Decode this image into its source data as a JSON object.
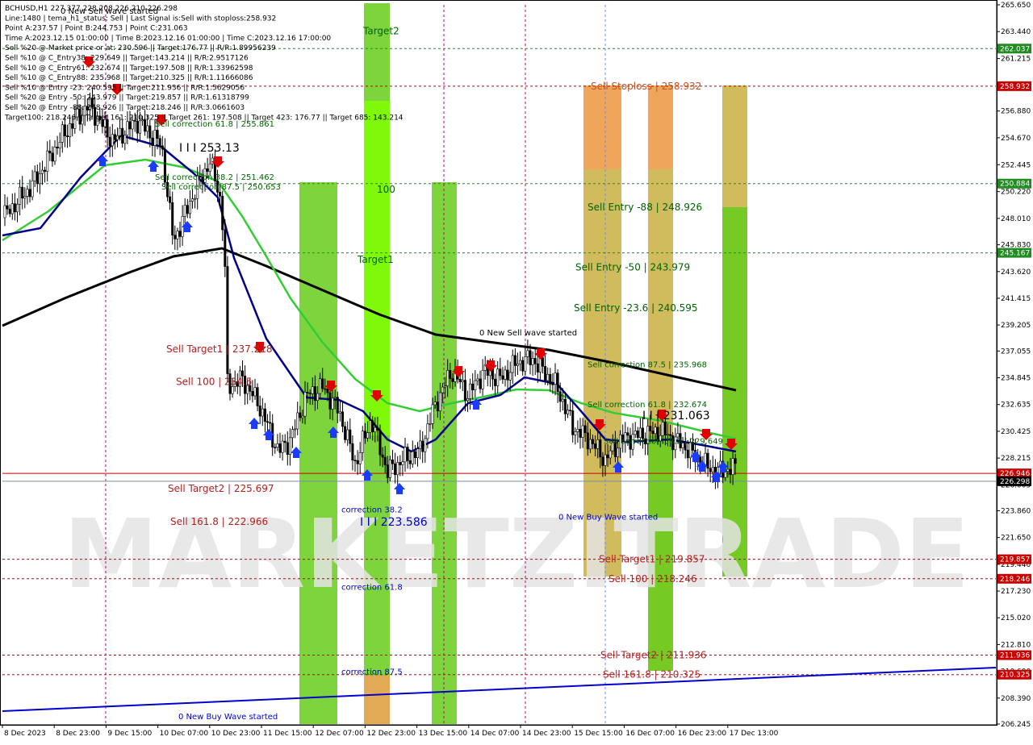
{
  "header": {
    "lines": [
      "BCHUSD,H1  227.377 228.208 226.210 226.298",
      "Line:1480 | tema_h1_status: Sell | Last Signal is:Sell with stoploss:258.932",
      "Point A:237.57 | Point B:244.753 | Point C:231.063",
      "Time A:2023.12.15 01:00:00 | Time B:2023.12.16 01:00:00 | Time C:2023.12.16 17:00:00",
      "Sell %20 @ Market price or at: 230.596 || Target:176.77 || R/R:1.89956239",
      "Sell %10 @ C_Entry38: 229.649 || Target:143.214 || R/R:2.9517126",
      "Sell %10 @ C_Entry61: 232.674 || Target:197.508 || R/R:1.33962598",
      "Sell %10 @ C_Entry88: 235.968 || Target:210.325 || R/R:1.11666086",
      "Sell %10 @ Entry -23: 240.595 || Target:211.936 || R/R:1.5629056",
      "Sell %20 @ Entry -50: 243.979 || Target:219.857 || R/R:1.61318799",
      "Sell %20 @ Entry -88: 248.926 || Target:218.246 || R/R:3.0661603",
      "Target100: 218.246 || Target 161: 210.325 || Target 261: 197.508 || Target 423: 176.77 || Target 685: 143.214"
    ]
  },
  "watermark": "MARKETZITRADE",
  "colors": {
    "background": "#ffffff",
    "green_band": "#66cc1a",
    "bright_green": "#7fff00",
    "orange_band": "#f5a25a",
    "olive_band": "#c8b040",
    "navy_ma": "#00008b",
    "green_ma": "#32cd32",
    "black_ma": "#000000",
    "sell_red": "#b22222",
    "buy_blue": "#0000cd",
    "current_price_tag": "#000000",
    "level_tag": "#c80000",
    "green_tag": "#228b22"
  },
  "chart_data": {
    "type": "candlestick",
    "symbol": "BCHUSD",
    "timeframe": "H1",
    "ylim": [
      206.245,
      265.65
    ],
    "price_ticks": [
      "265.650",
      "263.440",
      "261.215",
      "258.990",
      "256.880",
      "254.670",
      "252.445",
      "250.220",
      "248.010",
      "245.830",
      "243.620",
      "241.415",
      "239.205",
      "237.055",
      "234.845",
      "232.635",
      "230.425",
      "228.215",
      "226.005",
      "223.860",
      "221.650",
      "219.440",
      "217.230",
      "215.020",
      "212.810",
      "210.600",
      "208.390",
      "206.245"
    ],
    "date_labels": [
      "8 Dec 2023",
      "8 Dec 23:00",
      "9 Dec 15:00",
      "10 Dec 07:00",
      "10 Dec 23:00",
      "11 Dec 15:00",
      "12 Dec 07:00",
      "12 Dec 23:00",
      "13 Dec 15:00",
      "14 Dec 07:00",
      "14 Dec 23:00",
      "15 Dec 15:00",
      "16 Dec 07:00",
      "16 Dec 23:00",
      "17 Dec 13:00"
    ],
    "price_tags": [
      {
        "label": "262.037",
        "price": 262.037,
        "kind": "green"
      },
      {
        "label": "258.932",
        "price": 258.932,
        "kind": "red"
      },
      {
        "label": "250.884",
        "price": 250.884,
        "kind": "green"
      },
      {
        "label": "245.167",
        "price": 245.167,
        "kind": "green"
      },
      {
        "label": "226.946",
        "price": 226.946,
        "kind": "red"
      },
      {
        "label": "226.298",
        "price": 226.298,
        "kind": "current"
      },
      {
        "label": "219.857",
        "price": 219.857,
        "kind": "red"
      },
      {
        "label": "218.246",
        "price": 218.246,
        "kind": "red"
      },
      {
        "label": "211.936",
        "price": 211.936,
        "kind": "red"
      },
      {
        "label": "210.325",
        "price": 210.325,
        "kind": "red"
      }
    ],
    "annotations": [
      {
        "text": "Sell Stoploss | 258.932",
        "price": 258.932,
        "color": "#c8501e"
      },
      {
        "text": "Sell Entry -88 | 248.926",
        "price": 248.926,
        "color": "#006400"
      },
      {
        "text": "Sell Entry -50 | 243.979",
        "price": 243.979,
        "color": "#006400"
      },
      {
        "text": "Sell Entry -23.6 | 240.595",
        "price": 240.595,
        "color": "#006400"
      },
      {
        "text": "Sell correction 87.5 | 235.968",
        "price": 235.968,
        "color": "#006400"
      },
      {
        "text": "Sell correction 61.8 | 232.674",
        "price": 232.674,
        "color": "#006400"
      },
      {
        "text": "Sell correction 38.2 | 229.649",
        "price": 229.649,
        "color": "#006400"
      },
      {
        "text": "Sell Target1 | 219.857",
        "price": 219.857,
        "color": "#b22222"
      },
      {
        "text": "Sell 100 | 218.246",
        "price": 218.246,
        "color": "#b22222"
      },
      {
        "text": "Sell Target2 | 211.936",
        "price": 211.936,
        "color": "#b22222"
      },
      {
        "text": "Sell 161.8 | 210.325",
        "price": 210.325,
        "color": "#b22222"
      },
      {
        "text": "Sell Target1 | 237.218",
        "price": 237.218,
        "color": "#b22222"
      },
      {
        "text": "Sell 100 | 234.5",
        "price": 234.5,
        "color": "#b22222"
      },
      {
        "text": "Sell Target2 | 225.697",
        "price": 225.697,
        "color": "#b22222"
      },
      {
        "text": "Sell 161.8 | 222.966",
        "price": 222.966,
        "color": "#b22222"
      },
      {
        "text": "Sell correction 61.8 | 255.861",
        "price": 255.861,
        "color": "#006400"
      },
      {
        "text": "Sell correction 87.5 | 250.653",
        "price": 250.653,
        "color": "#006400"
      },
      {
        "text": "Sell correction 38.2 | 251.462",
        "price": 251.462,
        "color": "#006400"
      },
      {
        "text": "Target2",
        "price": 263.5,
        "color": "#006400"
      },
      {
        "text": "100",
        "price": 250.4,
        "color": "#006400"
      },
      {
        "text": "Target1",
        "price": 244.6,
        "color": "#006400"
      },
      {
        "text": "0 New Sell wave started",
        "price": 238.6,
        "color": "#000000"
      },
      {
        "text": "0 New Sell wave started",
        "price": 265.2,
        "color": "#000000"
      },
      {
        "text": "0 New Buy Wave started",
        "price": 223.4,
        "color": "#0000cd"
      },
      {
        "text": "0 New Buy Wave started",
        "price": 206.9,
        "color": "#0000cd"
      },
      {
        "text": "correction 38.2",
        "price": 224.0,
        "color": "#0000cd"
      },
      {
        "text": "correction 61.8",
        "price": 217.6,
        "color": "#0000cd"
      },
      {
        "text": "correction 87.5",
        "price": 210.6,
        "color": "#0000cd"
      },
      {
        "text": "I I I 253.13",
        "price": 253.8,
        "color": "#000000"
      },
      {
        "text": "I I I 223.586",
        "price": 222.9,
        "color": "#0000cd"
      },
      {
        "text": "I I I 231.063",
        "price": 231.7,
        "color": "#000000"
      }
    ],
    "grid": false
  }
}
